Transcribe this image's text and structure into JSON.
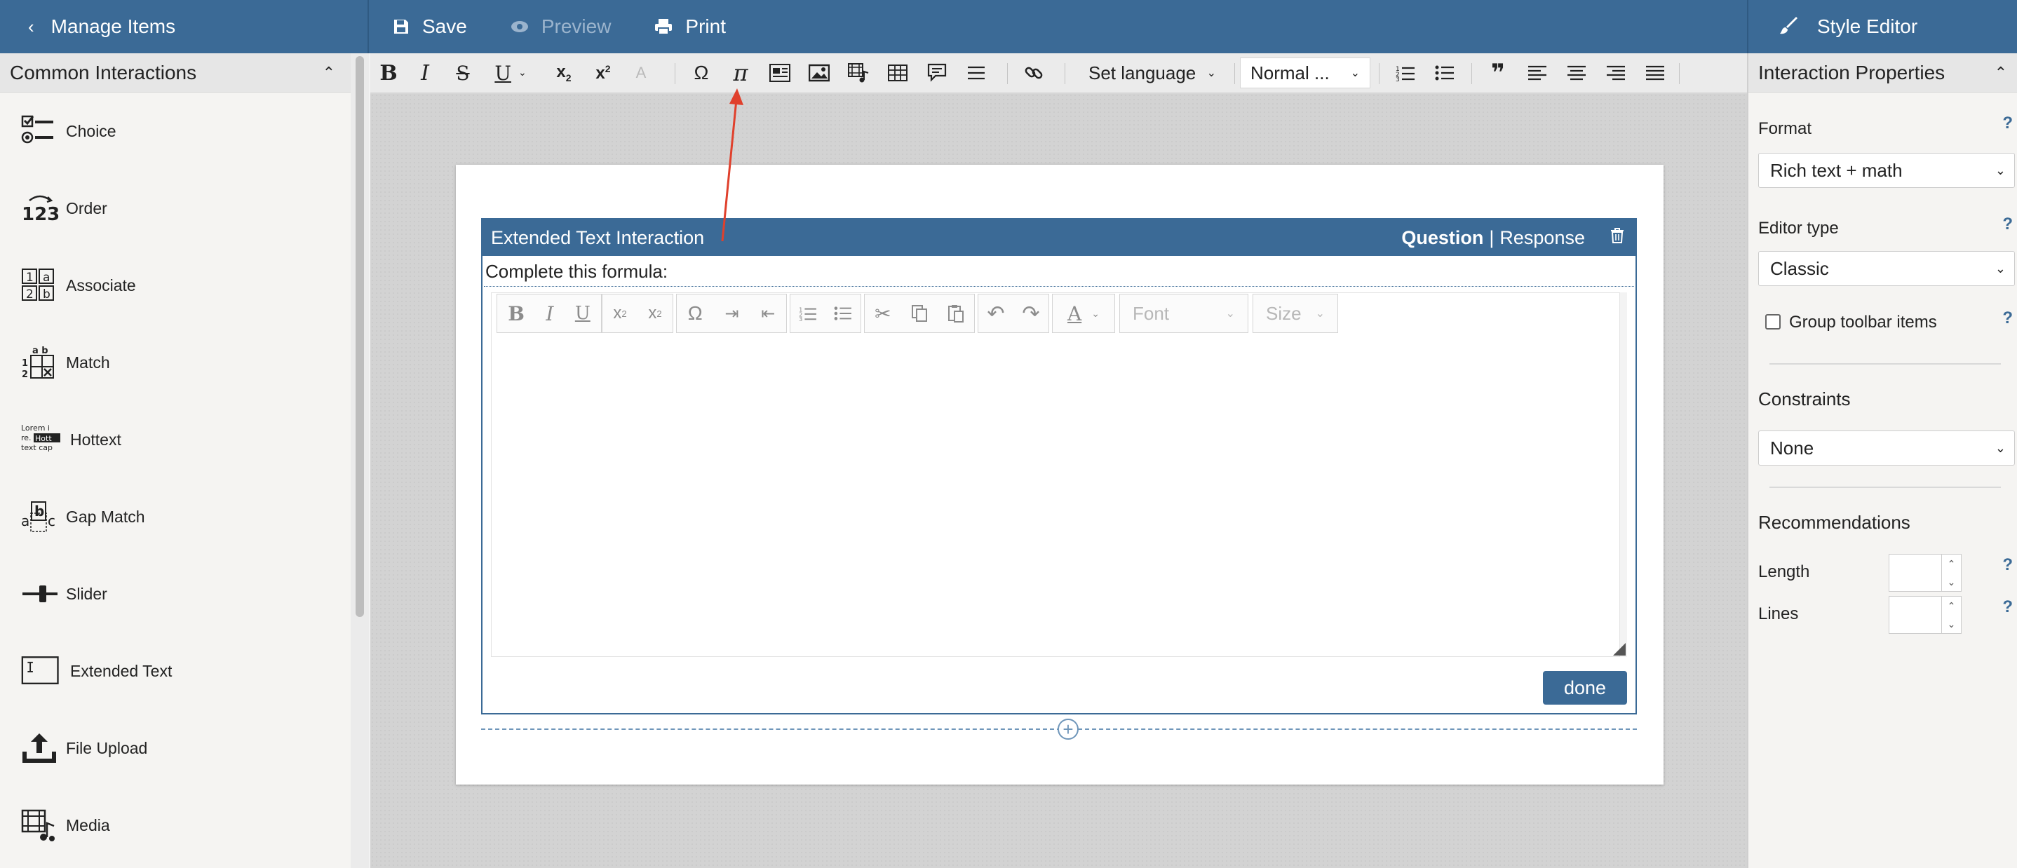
{
  "topbar": {
    "back_label": "Manage Items",
    "save_label": "Save",
    "preview_label": "Preview",
    "print_label": "Print",
    "style_editor_label": "Style Editor"
  },
  "sidebar": {
    "section_title": "Common Interactions",
    "items": [
      {
        "label": "Choice",
        "icon": "choice-icon"
      },
      {
        "label": "Order",
        "icon": "order-icon"
      },
      {
        "label": "Associate",
        "icon": "associate-icon"
      },
      {
        "label": "Match",
        "icon": "match-icon"
      },
      {
        "label": "Hottext",
        "icon": "hottext-icon"
      },
      {
        "label": "Gap Match",
        "icon": "gap-match-icon"
      },
      {
        "label": "Slider",
        "icon": "slider-icon"
      },
      {
        "label": "Extended Text",
        "icon": "extended-text-icon"
      },
      {
        "label": "File Upload",
        "icon": "file-upload-icon"
      },
      {
        "label": "Media",
        "icon": "media-icon"
      }
    ],
    "icon_text": {
      "order": "123",
      "associate_a": "1",
      "associate_b": "a",
      "associate_c": "2",
      "associate_d": "b",
      "match_ab": "a b",
      "match_12": "1 2",
      "hottext_1": "Lorem i",
      "hottext_2": "re.",
      "hottext_3": "Hott",
      "hottext_4": "text cap",
      "gap_a": "a",
      "gap_b": "b",
      "gap_c": "c"
    }
  },
  "main_toolbar": {
    "set_language_label": "Set language",
    "format_label": "Normal ..."
  },
  "interaction": {
    "title": "Extended Text Interaction",
    "tab_question": "Question",
    "tab_separator": "|",
    "tab_response": "Response",
    "prompt": "Complete this formula:",
    "editor_font_label": "Font",
    "editor_size_label": "Size",
    "done_label": "done"
  },
  "right_panel": {
    "section_title": "Interaction Properties",
    "format_label": "Format",
    "format_value": "Rich text + math",
    "editor_type_label": "Editor type",
    "editor_type_value": "Classic",
    "group_toolbar_label": "Group toolbar items",
    "constraints_label": "Constraints",
    "constraints_value": "None",
    "recommendations_label": "Recommendations",
    "length_label": "Length",
    "lines_label": "Lines",
    "help_mark": "?"
  },
  "colors": {
    "brand": "#3b6a96",
    "annotation_arrow": "#e0402c"
  }
}
